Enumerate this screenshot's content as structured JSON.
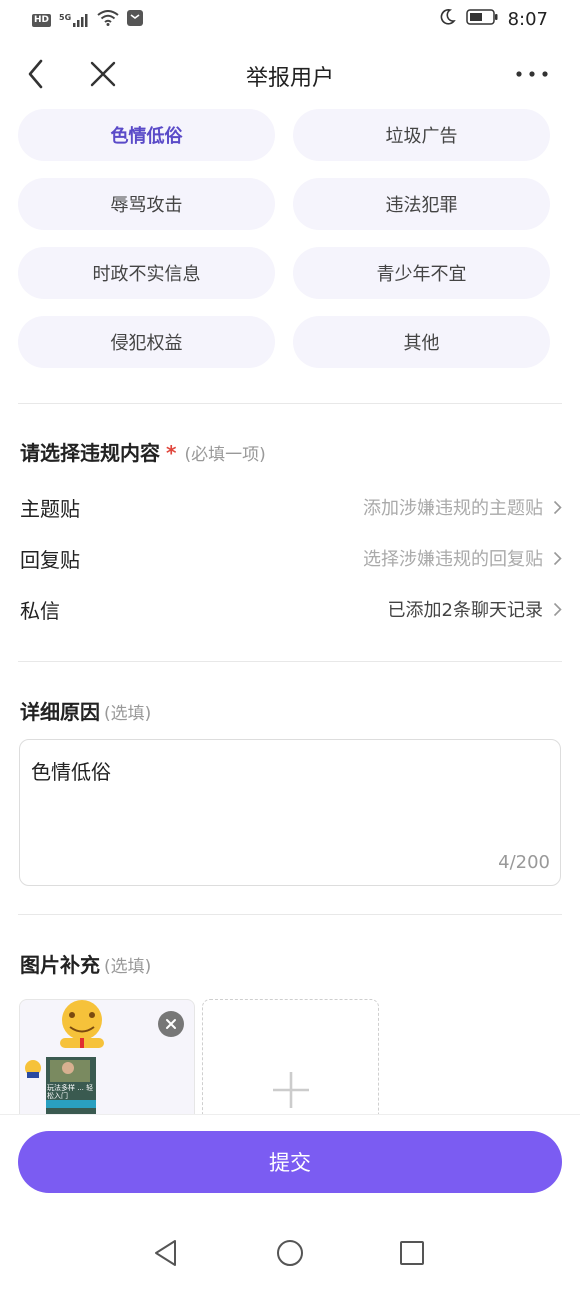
{
  "status_bar": {
    "network_label": "HD",
    "network_gen": "5G",
    "time": "8:07",
    "icons": [
      "signal-icon",
      "wifi-icon",
      "notification-icon",
      "moon-icon",
      "battery-icon"
    ]
  },
  "header": {
    "title": "举报用户",
    "icons": [
      "back-arrow-icon",
      "close-icon",
      "more-icon"
    ]
  },
  "report_types": {
    "selected": "色情低俗",
    "items": [
      "色情低俗",
      "垃圾广告",
      "辱骂攻击",
      "违法犯罪",
      "时政不实信息",
      "青少年不宜",
      "侵犯权益",
      "其他"
    ]
  },
  "violation_section": {
    "title": "请选择违规内容",
    "required_mark": "*",
    "hint": "(必填一项)",
    "rows": [
      {
        "label": "主题贴",
        "value": "添加涉嫌违规的主题贴"
      },
      {
        "label": "回复贴",
        "value": "选择涉嫌违规的回复贴"
      },
      {
        "label": "私信",
        "value": "已添加2条聊天记录"
      }
    ]
  },
  "reason_section": {
    "title": "详细原因",
    "hint": "(选填)",
    "text": "色情低俗",
    "char_count": "4/200"
  },
  "image_section": {
    "title": "图片补充",
    "hint": "(选填)",
    "thumb_overlay_text": "玩法多样 ... 轻松入门"
  },
  "submit": {
    "label": "提交",
    "color": "#7b5cf2"
  },
  "colors": {
    "accent": "#7b5cf2",
    "selected_tag_text": "#5a4ac8",
    "tag_bg": "#f5f4fc",
    "required": "#e0463c"
  }
}
